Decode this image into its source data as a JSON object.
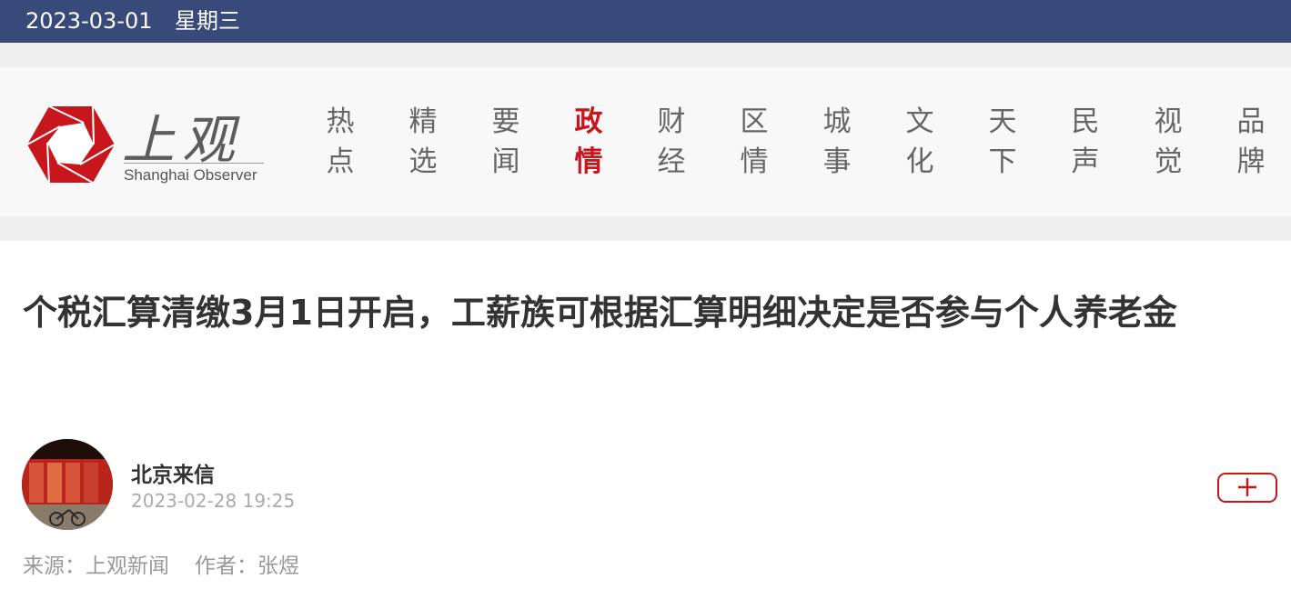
{
  "topbar": {
    "date": "2023-03-01",
    "weekday": "星期三"
  },
  "logo": {
    "name_cn": "上观",
    "name_en": "Shanghai Observer",
    "brand_color": "#c8161d"
  },
  "nav": {
    "items": [
      {
        "line1": "热",
        "line2": "点"
      },
      {
        "line1": "精",
        "line2": "选"
      },
      {
        "line1": "要",
        "line2": "闻"
      },
      {
        "line1": "政",
        "line2": "情"
      },
      {
        "line1": "财",
        "line2": "经"
      },
      {
        "line1": "区",
        "line2": "情"
      },
      {
        "line1": "城",
        "line2": "事"
      },
      {
        "line1": "文",
        "line2": "化"
      },
      {
        "line1": "天",
        "line2": "下"
      },
      {
        "line1": "民",
        "line2": "声"
      },
      {
        "line1": "视",
        "line2": "觉"
      },
      {
        "line1": "品",
        "line2": "牌"
      }
    ],
    "active_index": 3,
    "active_color": "#c8161d"
  },
  "article": {
    "title": "个税汇算清缴3月1日开启，工薪族可根据汇算明细决定是否参与个人养老金",
    "author": {
      "name": "北京来信",
      "publish_time": "2023-02-28 19:25"
    },
    "follow_icon": "plus-icon",
    "source_label": "来源：上观新闻",
    "author_label": "作者：张煜"
  },
  "colors": {
    "topbar_bg": "#374a7a",
    "header_band": "#efefef",
    "header_bg": "#f8f8f8"
  }
}
